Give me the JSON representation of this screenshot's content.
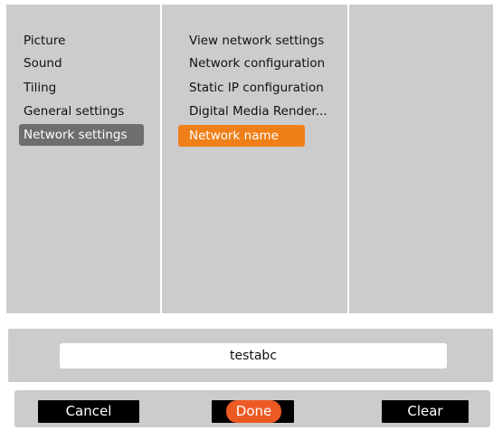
{
  "menu": {
    "level1": {
      "items": [
        {
          "label": "Picture",
          "selected": false
        },
        {
          "label": "Sound",
          "selected": false
        },
        {
          "label": "Tiling",
          "selected": false
        },
        {
          "label": "General settings",
          "selected": false
        },
        {
          "label": "Network settings",
          "selected": true
        }
      ]
    },
    "level2": {
      "items": [
        {
          "label": "View network settings",
          "selected": false
        },
        {
          "label": "Network configuration",
          "selected": false
        },
        {
          "label": "Static IP configuration",
          "selected": false
        },
        {
          "label": "Digital Media Render...",
          "selected": false
        },
        {
          "label": "Network name",
          "selected": true
        }
      ]
    }
  },
  "name_input": {
    "value": "testabc"
  },
  "buttons": {
    "cancel_label": "Cancel",
    "done_label": "Done",
    "clear_label": "Clear"
  },
  "colors": {
    "panel_background": "#cccccc",
    "level1_highlight": "#6e6e6e",
    "level2_highlight": "#ef7f18",
    "done_highlight": "#ec5a24",
    "button_background": "#000000"
  }
}
